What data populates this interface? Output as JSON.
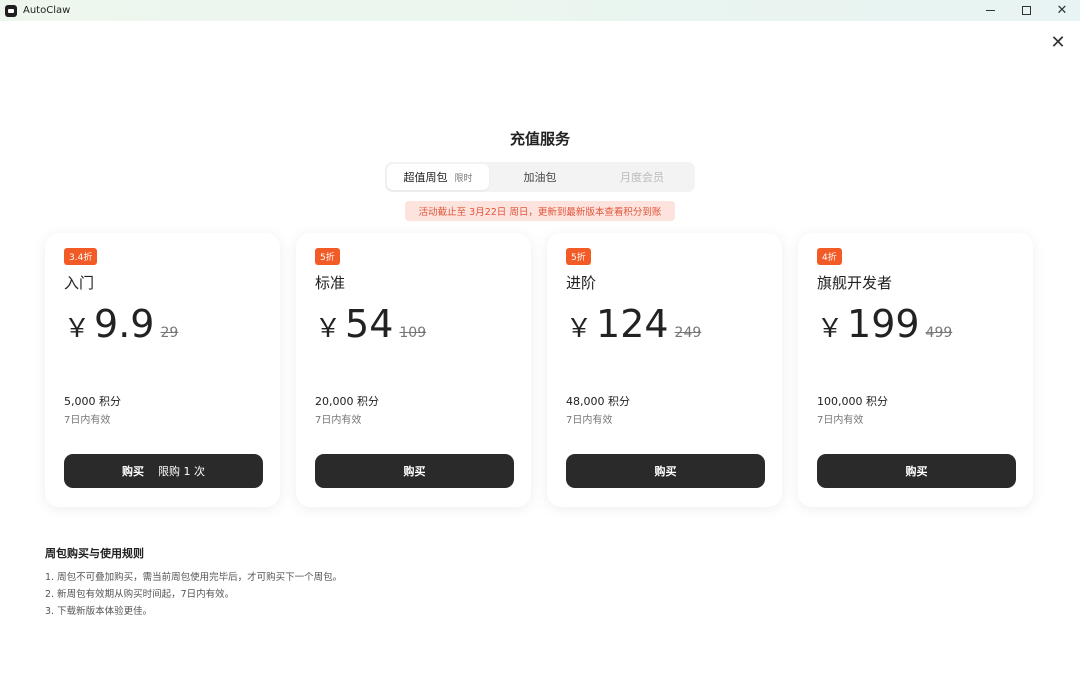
{
  "window": {
    "title": "AutoClaw"
  },
  "page": {
    "title": "充值服务"
  },
  "tabs": [
    {
      "label": "超值周包",
      "tag": "限时",
      "active": true
    },
    {
      "label": "加油包",
      "active": false
    },
    {
      "label": "月度会员",
      "active": false,
      "disabled": true
    }
  ],
  "notice": "活动截止至 3月22日 周日，更新到最新版本查看积分到账",
  "plans": [
    {
      "badge": "3.4折",
      "name": "入门",
      "currency": "￥",
      "price": "9.9",
      "original": "29",
      "points": "5,000 积分",
      "validity": "7日内有效",
      "button": "购买",
      "button_extra": "限购 1 次"
    },
    {
      "badge": "5折",
      "name": "标准",
      "currency": "￥",
      "price": "54",
      "original": "109",
      "points": "20,000 积分",
      "validity": "7日内有效",
      "button": "购买"
    },
    {
      "badge": "5折",
      "name": "进阶",
      "currency": "￥",
      "price": "124",
      "original": "249",
      "points": "48,000 积分",
      "validity": "7日内有效",
      "button": "购买"
    },
    {
      "badge": "4折",
      "name": "旗舰开发者",
      "currency": "￥",
      "price": "199",
      "original": "499",
      "points": "100,000 积分",
      "validity": "7日内有效",
      "button": "购买"
    }
  ],
  "rules": {
    "title": "周包购买与使用规则",
    "items": [
      "1. 周包不可叠加购买，需当前周包使用完毕后，才可购买下一个周包。",
      "2. 新周包有效期从购买时间起，7日内有效。",
      "3. 下载新版本体验更佳。"
    ]
  },
  "colors": {
    "badge": "#f25b26",
    "button": "#2a2a2a",
    "notice_bg": "#fde3dd",
    "notice_text": "#e0553b"
  }
}
